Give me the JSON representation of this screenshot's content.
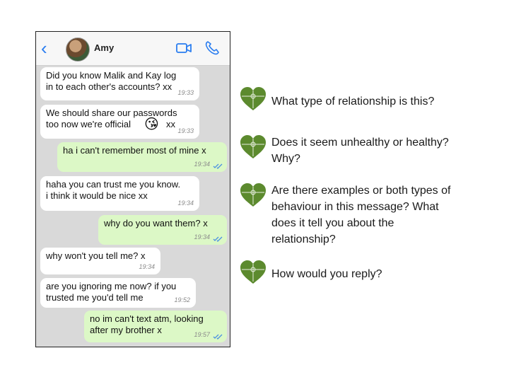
{
  "chat": {
    "contact_name": "Amy",
    "back_icon": "chevron-left-icon",
    "video_icon": "video-camera-icon",
    "call_icon": "phone-icon",
    "accent_color": "#2a7df0",
    "messages": [
      {
        "dir": "in",
        "text": "Did you know Malik and Kay log\nin to each other's accounts? xx",
        "time": "19:33"
      },
      {
        "dir": "in",
        "text": "We should share our passwords\ntoo now we're official",
        "emoji": "😘",
        "emoji_suffix": "xx",
        "time": "19:33"
      },
      {
        "dir": "out",
        "text": "ha i can't remember most of mine x",
        "time": "19:34"
      },
      {
        "dir": "in",
        "text": "haha you can trust me you know.\n i think it would be nice xx",
        "time": "19:34"
      },
      {
        "dir": "out",
        "text": "why do you want them? x",
        "time": "19:34"
      },
      {
        "dir": "in",
        "text": "why won't you tell me? x",
        "time": "19:34"
      },
      {
        "dir": "in",
        "text": "are you ignoring me now? if you\ntrusted me you'd tell me",
        "time": "19:52"
      },
      {
        "dir": "out",
        "text": "no im can't text atm, looking\nafter my brother x",
        "time": "19:57"
      }
    ]
  },
  "questions": [
    {
      "text": "What type of relationship is this?",
      "icon": "puzzle-heart-icon"
    },
    {
      "text": "Does it seem unhealthy or healthy?\nWhy?",
      "icon": "puzzle-heart-icon"
    },
    {
      "text": "Are there examples or both types of\nbehaviour in this message? What\ndoes it tell you about the\nrelationship?",
      "icon": "puzzle-heart-icon"
    },
    {
      "text": "How would you reply?",
      "icon": "puzzle-heart-icon"
    }
  ],
  "colors": {
    "incoming_bubble": "#ffffff",
    "outgoing_bubble": "#dcf8c6",
    "chat_background": "#d9d9d9",
    "heart_green": "#5c8a2e"
  }
}
